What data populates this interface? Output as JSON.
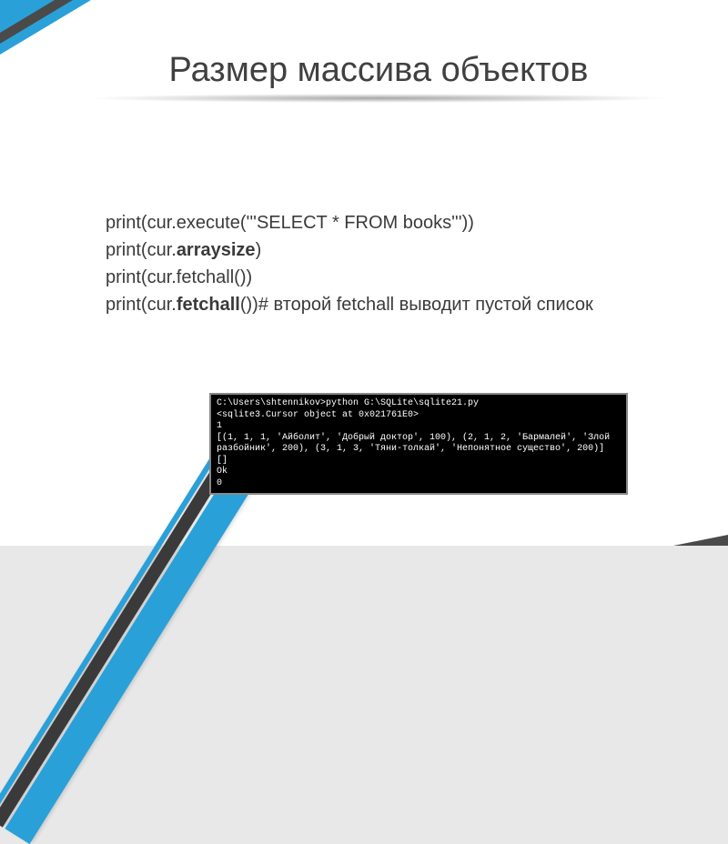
{
  "title": "Размер массива объектов",
  "code": {
    "line1_pre": "print(cur.execute('''SELECT * FROM books'''))",
    "line2_pre": "print(cur.",
    "line2_bold": "arraysize",
    "line2_post": ")",
    "line3_pre": "print(cur.fetchall())",
    "line4_pre": "print(cur.",
    "line4_bold": "fetchall",
    "line4_post": "())# второй fetchall выводит пустой список"
  },
  "terminal": {
    "l1": "C:\\Users\\shtennikov>python G:\\SQLite\\sqlite21.py",
    "l2": "<sqlite3.Cursor object at 0x021761E0>",
    "l3": "1",
    "l4": "[(1, 1, 1, 'Айболит', 'Добрый доктор', 100), (2, 1, 2, 'Бармалей', 'Злой разбойник', 200), (3, 1, 3, 'Тяни-толкай', 'Непонятное существо', 200)]",
    "l5": "[]",
    "l6": "Ok",
    "l7": "0"
  }
}
